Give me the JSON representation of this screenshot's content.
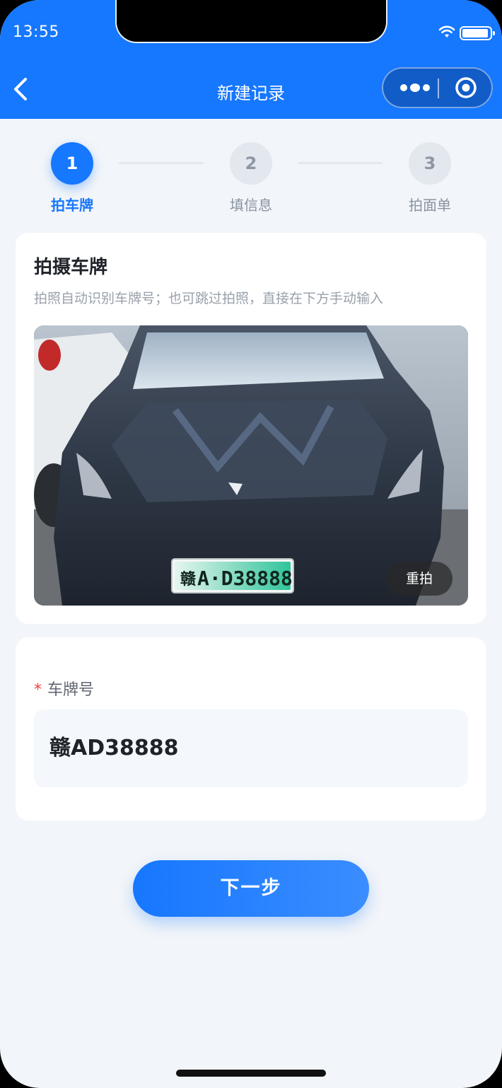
{
  "status_bar": {
    "time": "13:55"
  },
  "nav": {
    "title": "新建记录"
  },
  "steps": [
    {
      "number": "1",
      "label": "拍车牌",
      "active": true
    },
    {
      "number": "2",
      "label": "填信息",
      "active": false
    },
    {
      "number": "3",
      "label": "拍面单",
      "active": false
    }
  ],
  "photo_card": {
    "title": "拍摄车牌",
    "description": "拍照自动识别车牌号；也可跳过拍照，直接在下方手动输入",
    "plate_in_photo": {
      "province": "赣",
      "number": "A·D38888"
    },
    "retake_label": "重拍"
  },
  "plate_field": {
    "label": "车牌号",
    "required_mark": "*",
    "value": "赣AD38888"
  },
  "next_button": {
    "label": "下一步"
  },
  "colors": {
    "primary": "#1677ff",
    "background": "#f2f5f9",
    "required": "#f53f3f"
  }
}
